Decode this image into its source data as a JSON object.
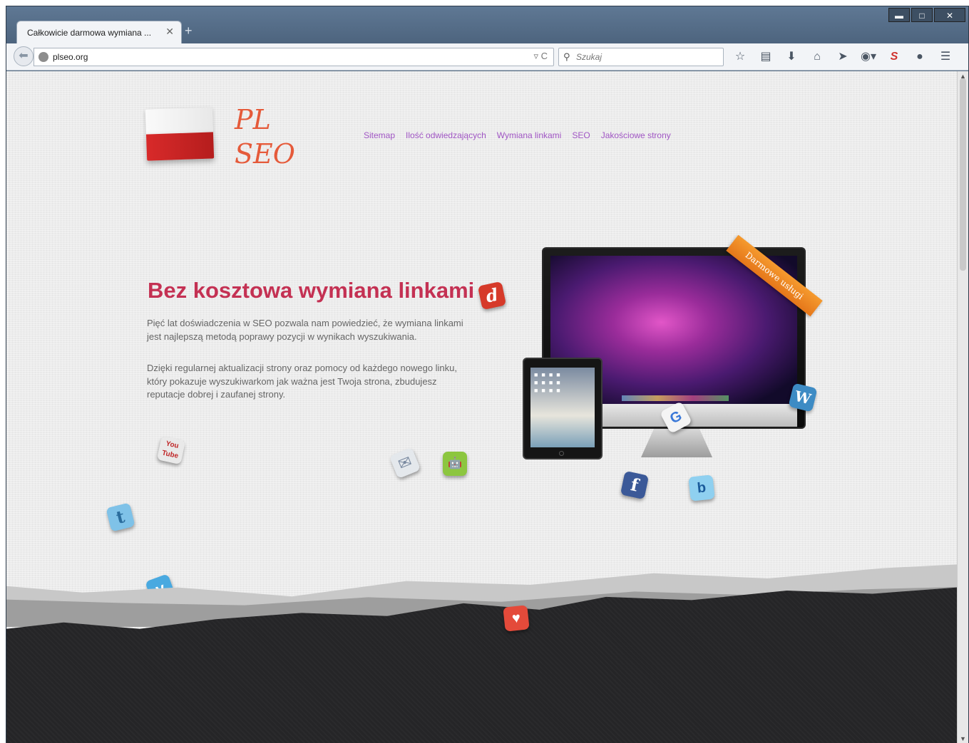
{
  "browser": {
    "tab_title": "Całkowicie darmowa wymiana ...",
    "tab_close": "✕",
    "new_tab": "+",
    "url": "plseo.org",
    "url_actions": "▿ C",
    "search_placeholder": "Szukaj",
    "window_buttons": {
      "minimize": "▬",
      "maximize": "□",
      "close": "✕"
    },
    "toolbar_icons": [
      "star-icon",
      "reading-list-icon",
      "download-icon",
      "home-icon",
      "send-icon",
      "addon-icon",
      "s-extension-icon",
      "chat-icon",
      "menu-icon"
    ]
  },
  "page": {
    "logo": {
      "line1": "PL",
      "line2": "SEO"
    },
    "nav": [
      "Sitemap",
      "Ilość odwiedzających",
      "Wymiana linkami",
      "SEO",
      "Jakościowe strony"
    ],
    "hero": {
      "title": "Bez kosztowa wymiana linkami",
      "p1": "Pięć lat doświadczenia w SEO pozwala nam powiedzieć, że wymiana linkami jest najlepszą metodą poprawy pozycji w wynikach wyszukiwania.",
      "p2": "Dzięki regularnej aktualizacji strony oraz pomocy od każdego nowego linku, który pokazuje wyszukiwarkom jak ważna jest Twoja strona, zbudujesz reputacje dobrej i zaufanej strony."
    },
    "ribbon": "Darmowe usługi",
    "social_icons": [
      {
        "name": "delicious-icon",
        "glyph": "d",
        "color": "#d63a2a"
      },
      {
        "name": "youtube-icon",
        "glyph": "You\nTube",
        "color": "#e9e9e9"
      },
      {
        "name": "twitter-icon",
        "glyph": "t",
        "color": "#7fc2e8"
      },
      {
        "name": "vimeo-icon",
        "glyph": "v",
        "color": "#49a9e0"
      },
      {
        "name": "email-icon",
        "glyph": "✉",
        "color": "#e4e8ec"
      },
      {
        "name": "android-icon",
        "glyph": "🤖",
        "color": "#8cc63f"
      },
      {
        "name": "facebook-icon",
        "glyph": "f",
        "color": "#3b5998"
      },
      {
        "name": "bebo-icon",
        "glyph": "b",
        "color": "#8fd0f0"
      },
      {
        "name": "wordpress-icon",
        "glyph": "W",
        "color": "#3d8bc4"
      },
      {
        "name": "google-icon",
        "glyph": "G",
        "color": "#f4f4f4"
      },
      {
        "name": "heart-icon",
        "glyph": "♥",
        "color": "#e44a3a"
      }
    ],
    "colors": {
      "accent_title": "#c43153",
      "nav": "#a055c4",
      "logo": "#e55a3a"
    }
  }
}
